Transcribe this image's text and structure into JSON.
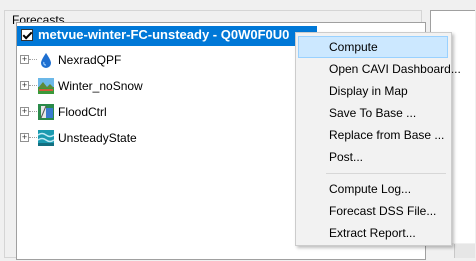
{
  "panel": {
    "title": "Forecasts"
  },
  "tree": {
    "selected": {
      "label": "metvue-winter-FC-unsteady - Q0W0F0U0"
    },
    "nodes": [
      {
        "label": "NexradQPF",
        "icon": "water-drop-icon"
      },
      {
        "label": "Winter_noSnow",
        "icon": "landscape-icon"
      },
      {
        "label": "FloodCtrl",
        "icon": "dam-icon"
      },
      {
        "label": "UnsteadyState",
        "icon": "waves-icon"
      }
    ]
  },
  "context_menu": {
    "items": [
      {
        "label": "Compute"
      },
      {
        "label": "Open CAVI Dashboard..."
      },
      {
        "label": "Display in Map"
      },
      {
        "label": "Save To Base ..."
      },
      {
        "label": "Replace from Base ..."
      },
      {
        "label": "Post..."
      },
      {
        "label": "Compute Log..."
      },
      {
        "label": "Forecast DSS File..."
      },
      {
        "label": "Extract Report..."
      }
    ]
  },
  "colors": {
    "selection": "#0078d7",
    "menu_highlight": "#cce8ff",
    "menu_bg": "#f2f2f2"
  }
}
